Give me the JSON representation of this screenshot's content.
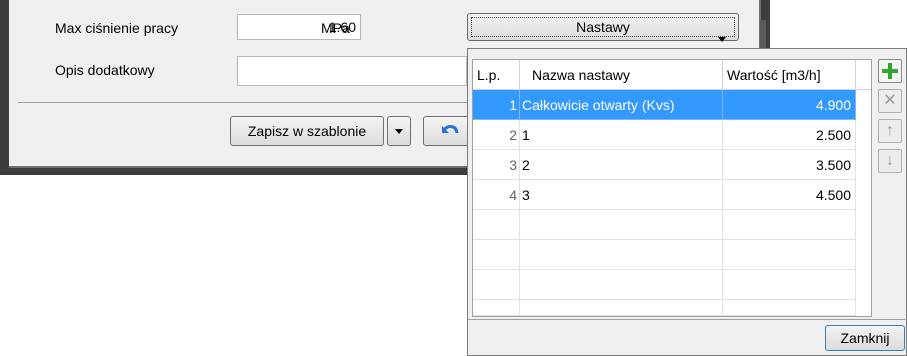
{
  "form": {
    "max_pressure_label": "Max ciśnienie pracy",
    "max_pressure_value": "1.60",
    "max_pressure_unit": "MPa",
    "description_label": "Opis dodatkowy",
    "description_value": "",
    "settings_dropdown_value": "Nastawy",
    "save_template_label": "Zapisz w szablonie"
  },
  "popup": {
    "columns": [
      "L.p.",
      "Nazwa nastawy",
      "Wartość [m3/h]"
    ],
    "rows": [
      {
        "lp": "1",
        "name": "Całkowicie otwarty (Kvs)",
        "value": "4.900",
        "selected": true
      },
      {
        "lp": "2",
        "name": "1",
        "value": "2.500"
      },
      {
        "lp": "3",
        "name": "2",
        "value": "3.500"
      },
      {
        "lp": "4",
        "name": "3",
        "value": "4.500"
      }
    ],
    "close_label": "Zamknij",
    "side_buttons": [
      "add-icon",
      "delete-icon",
      "move-up-icon",
      "move-down-icon"
    ],
    "colors": {
      "selection": "#3399ff",
      "add": "#2ea82e"
    }
  }
}
